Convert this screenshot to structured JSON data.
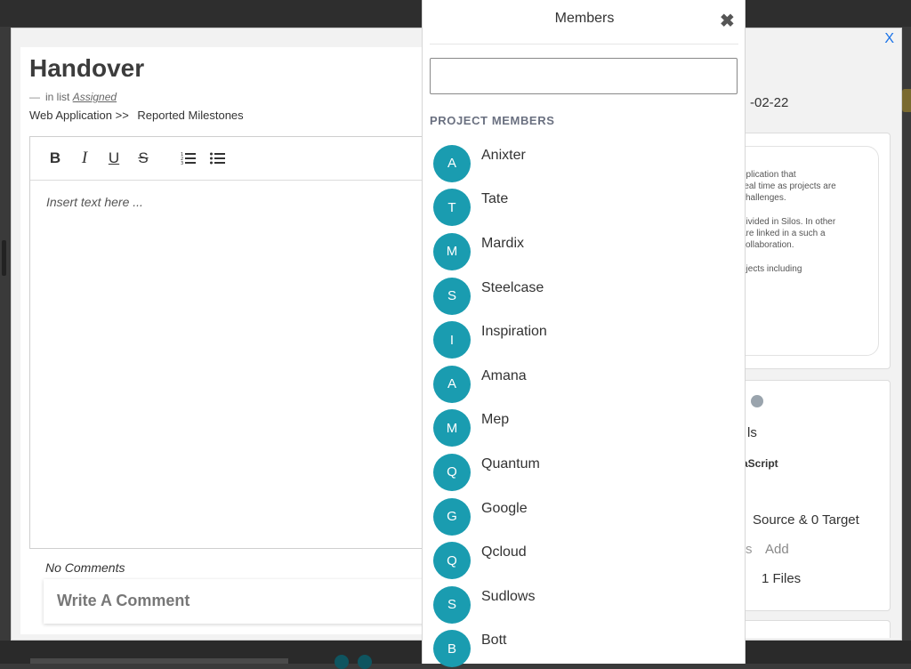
{
  "card": {
    "title": "Handover",
    "list_prefix": "in list",
    "list_name": "Assigned",
    "breadcrumb_project": "Web Application >>",
    "breadcrumb_section": "Reported Milestones",
    "editor_placeholder": "Insert text here ...",
    "no_comments": "No Comments",
    "comment_placeholder": "Write A Comment",
    "close_label": "X"
  },
  "toolbar": {
    "bold": "B",
    "italic": "I",
    "underline": "U",
    "strike": "S",
    "ordered_list": "1≡",
    "bullet_list": "•≡"
  },
  "right_panel": {
    "date_fragment": "-02-22",
    "description_lines": [
      "pplication that",
      "real time as projects are",
      "challenges.",
      "",
      "divided in Silos. In other",
      "are linked in a such a",
      "collaboration.",
      "",
      "ojects including"
    ],
    "tag_fragment": "ls",
    "language_fragment": "aScript",
    "links_text": "Source & 0 Target",
    "add_prefix": "s",
    "add_label": "Add",
    "files_text": "1 Files"
  },
  "members_popup": {
    "title": "Members",
    "search_value": "",
    "search_placeholder": "",
    "section_label": "PROJECT MEMBERS",
    "avatar_color": "#1a9cb0",
    "members": [
      {
        "initial": "A",
        "name": "Anixter"
      },
      {
        "initial": "T",
        "name": "Tate"
      },
      {
        "initial": "M",
        "name": "Mardix"
      },
      {
        "initial": "S",
        "name": "Steelcase"
      },
      {
        "initial": "I",
        "name": "Inspiration"
      },
      {
        "initial": "A",
        "name": "Amana"
      },
      {
        "initial": "M",
        "name": "Mep"
      },
      {
        "initial": "Q",
        "name": "Quantum"
      },
      {
        "initial": "G",
        "name": "Google"
      },
      {
        "initial": "Q",
        "name": "Qcloud"
      },
      {
        "initial": "S",
        "name": "Sudlows"
      },
      {
        "initial": "B",
        "name": "Bott"
      }
    ]
  }
}
